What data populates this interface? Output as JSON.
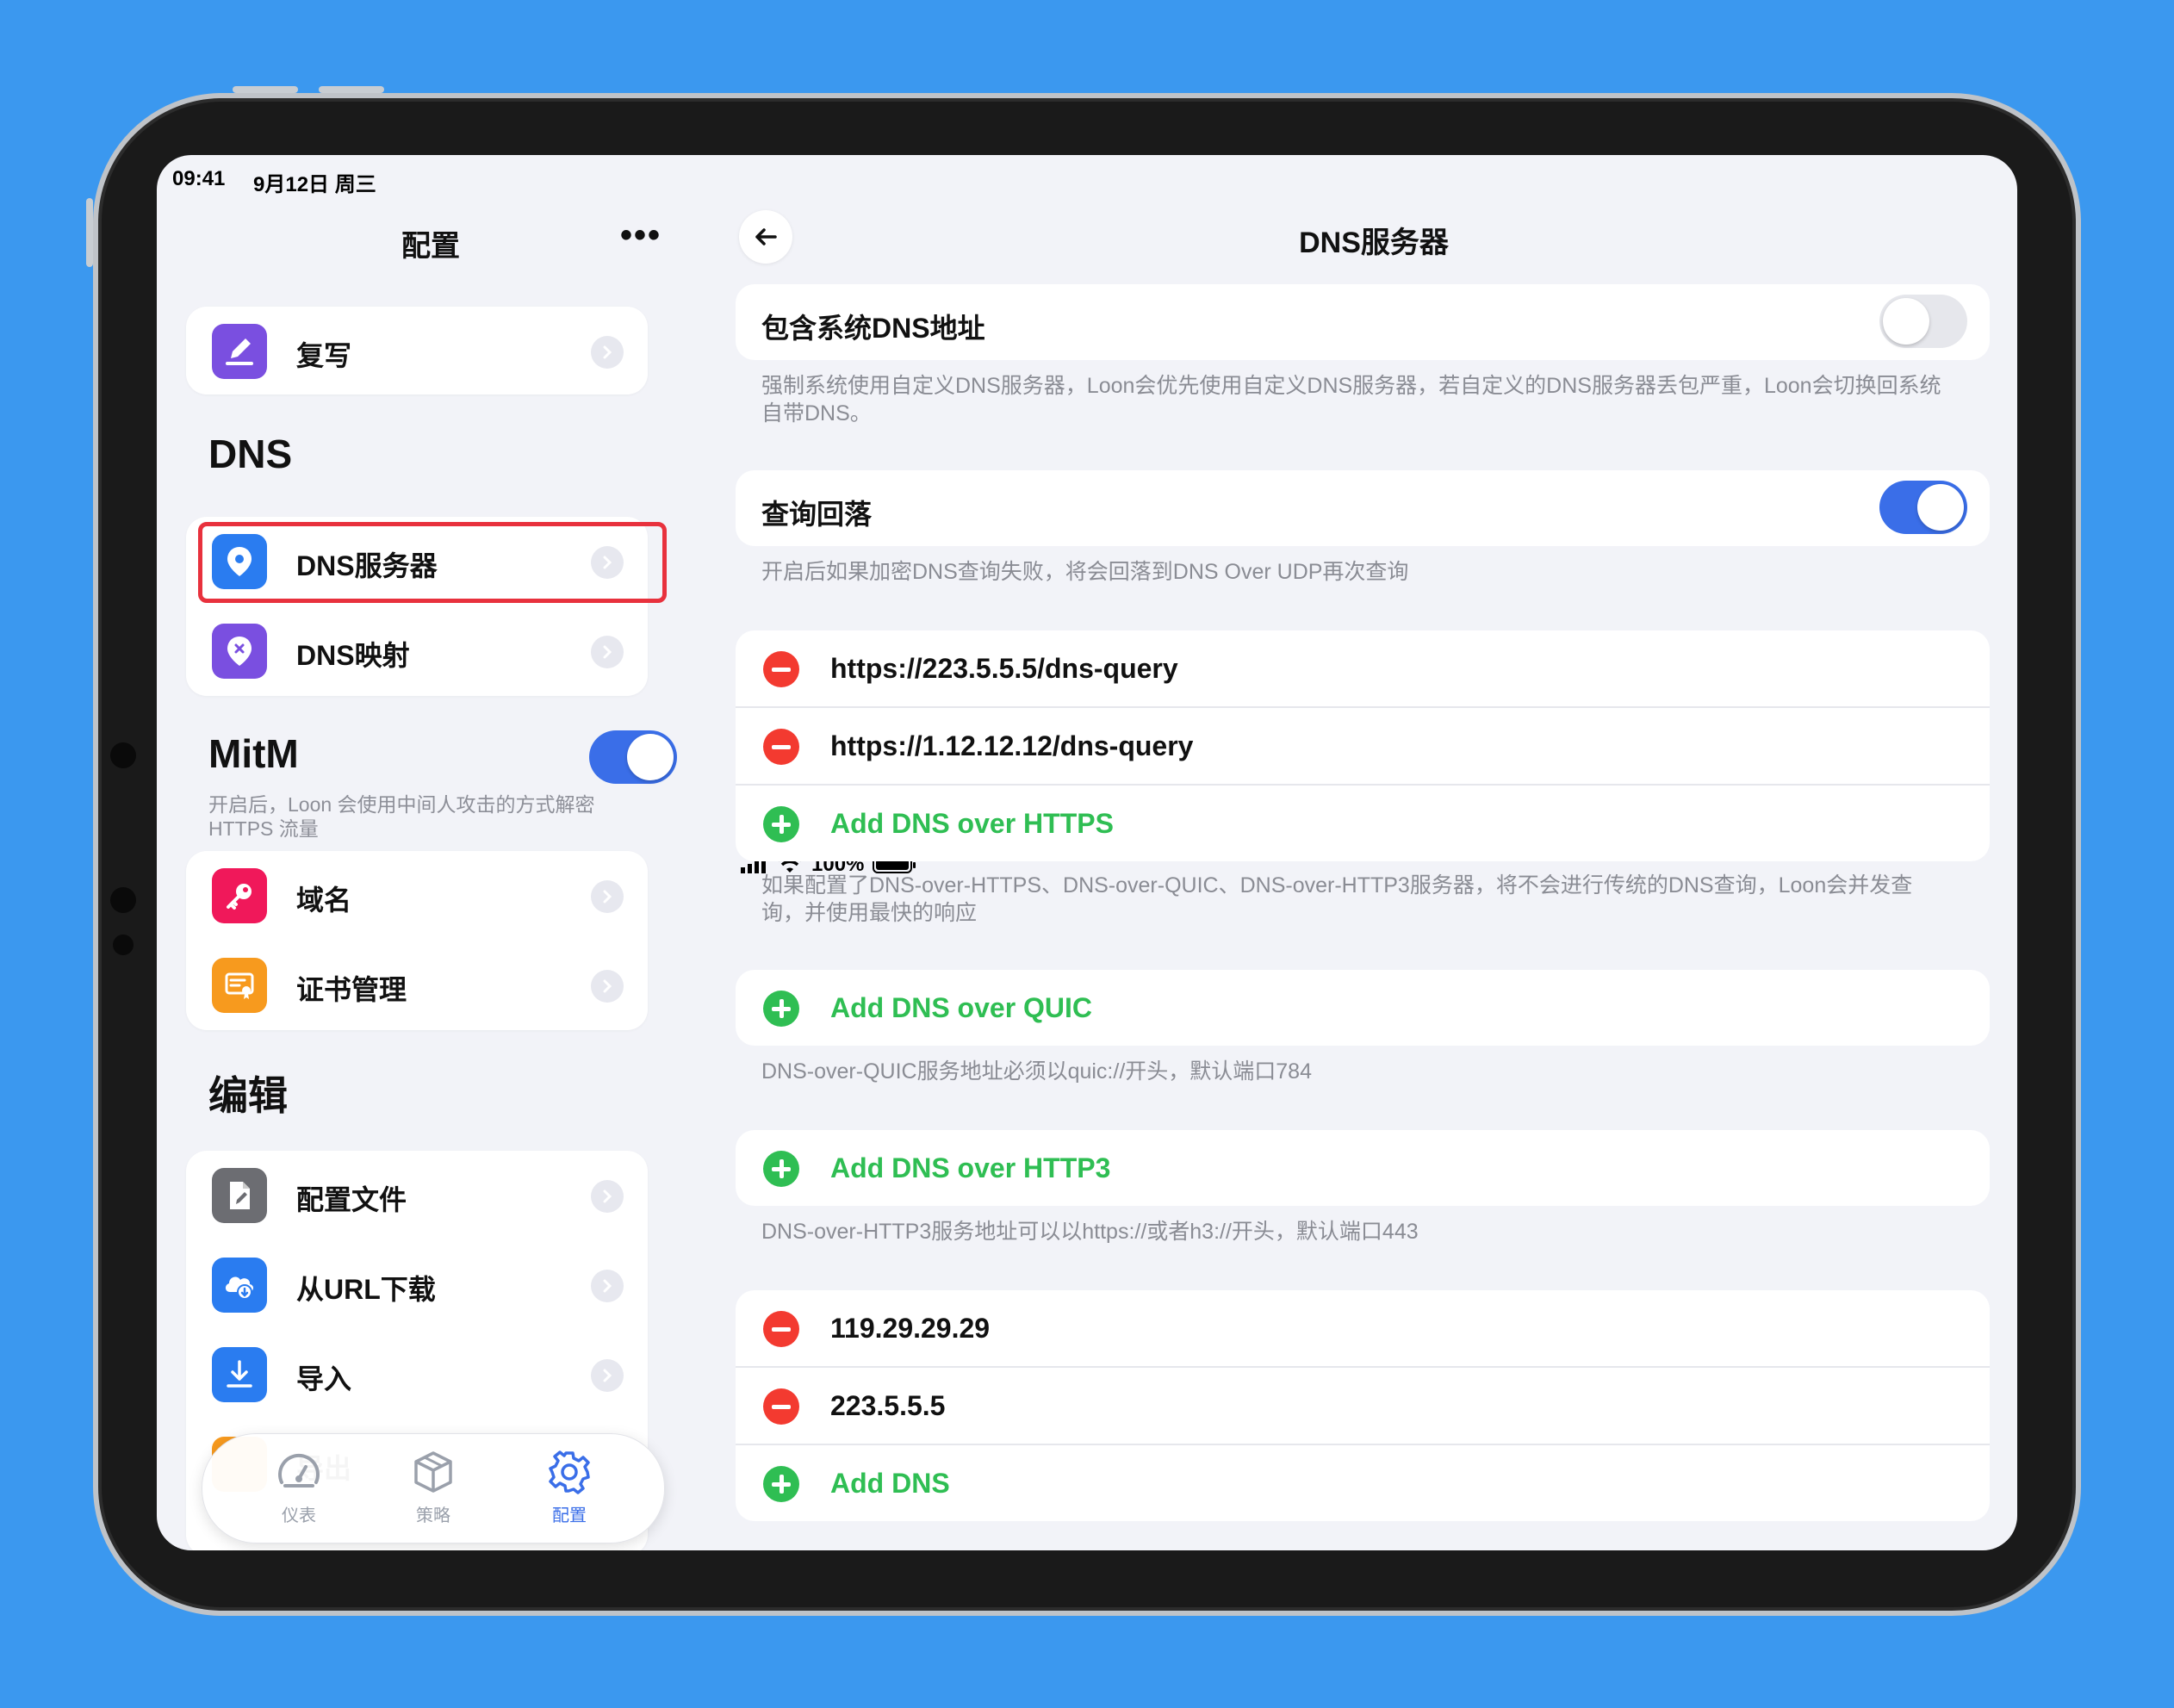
{
  "status": {
    "time": "09:41",
    "date": "9月12日 周三",
    "battery": "100%"
  },
  "left": {
    "title": "配置",
    "more": "•••",
    "rewrite": {
      "label": "复写",
      "icon": "pencil-icon",
      "color": "#7a4fe0"
    },
    "dns_heading": "DNS",
    "dns_items": [
      {
        "label": "DNS服务器",
        "icon": "location-pin-icon",
        "color": "#2a7cf0"
      },
      {
        "label": "DNS映射",
        "icon": "location-x-icon",
        "color": "#7a4fe0"
      }
    ],
    "mitm_heading": "MitM",
    "mitm_enabled": true,
    "mitm_desc": "开启后，Loon 会使用中间人攻击的方式解密 HTTPS 流量",
    "mitm_items": [
      {
        "label": "域名",
        "icon": "key-icon",
        "color": "#f0185a"
      },
      {
        "label": "证书管理",
        "icon": "certificate-icon",
        "color": "#f79a1e"
      }
    ],
    "edit_heading": "编辑",
    "edit_items": [
      {
        "label": "配置文件",
        "icon": "file-edit-icon",
        "color": "#6c6d72"
      },
      {
        "label": "从URL下载",
        "icon": "cloud-download-icon",
        "color": "#2a7cf0"
      },
      {
        "label": "导入",
        "icon": "import-icon",
        "color": "#2a7cf0"
      }
    ],
    "partial_item": "导出"
  },
  "tabbar": [
    {
      "label": "仪表",
      "icon": "gauge-icon",
      "active": false
    },
    {
      "label": "策略",
      "icon": "cube-icon",
      "active": false
    },
    {
      "label": "配置",
      "icon": "gear-icon",
      "active": true
    }
  ],
  "right": {
    "title": "DNS服务器",
    "include_system": {
      "label": "包含系统DNS地址",
      "enabled": false
    },
    "include_system_desc": "强制系统使用自定义DNS服务器，Loon会优先使用自定义DNS服务器，若自定义的DNS服务器丢包严重，Loon会切换回系统自带DNS。",
    "fallback": {
      "label": "查询回落",
      "enabled": true
    },
    "fallback_desc": "开启后如果加密DNS查询失败，将会回落到DNS Over UDP再次查询",
    "doh_servers": [
      "https://223.5.5.5/dns-query",
      "https://1.12.12.12/dns-query"
    ],
    "doh_add": "Add DNS over HTTPS",
    "doh_desc": "如果配置了DNS-over-HTTPS、DNS-over-QUIC、DNS-over-HTTP3服务器，将不会进行传统的DNS查询，Loon会并发查询，并使用最快的响应",
    "doq_add": "Add DNS over QUIC",
    "doq_desc": "DNS-over-QUIC服务地址必须以quic://开头，默认端口784",
    "doh3_add": "Add DNS over HTTP3",
    "doh3_desc": "DNS-over-HTTP3服务地址可以以https://或者h3://开头，默认端口443",
    "dns_servers": [
      "119.29.29.29",
      "223.5.5.5"
    ],
    "dns_add": "Add DNS"
  }
}
